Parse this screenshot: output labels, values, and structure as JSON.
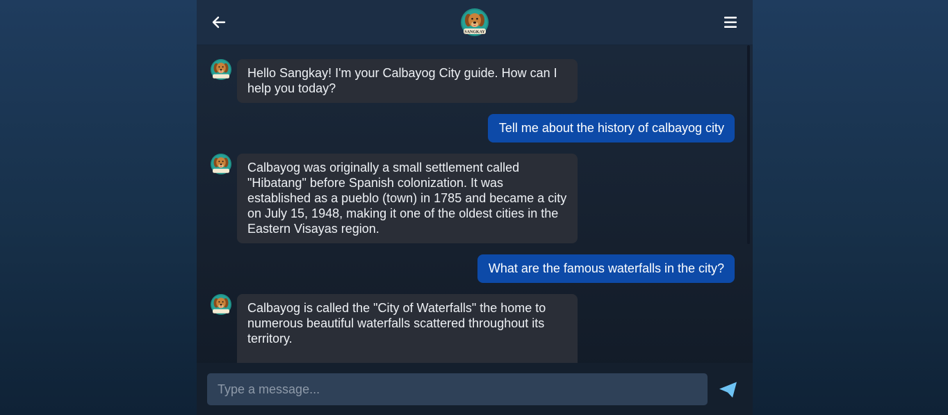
{
  "header": {
    "back_icon": "arrow-left-icon",
    "avatar_label": "SANGKAY",
    "menu_icon": "hamburger-menu-icon"
  },
  "messages": [
    {
      "role": "bot",
      "text": "Hello Sangkay! I'm your Calbayog City guide. How can I help you today?"
    },
    {
      "role": "user",
      "text": "Tell me about the history of calbayog city"
    },
    {
      "role": "bot",
      "text": "Calbayog was originally a small settlement called \"Hibatang\" before Spanish colonization. It was established as a pueblo (town) in 1785 and became a city on July 15, 1948, making it one of the oldest cities in the Eastern Visayas region."
    },
    {
      "role": "user",
      "text": "What are the famous waterfalls in the city?"
    },
    {
      "role": "bot",
      "text": "Calbayog is called the \"City of Waterfalls\" the home to numerous beautiful waterfalls scattered throughout its territory."
    }
  ],
  "composer": {
    "placeholder": "Type a message...",
    "value": "",
    "send_icon": "paper-plane-send-icon"
  },
  "colors": {
    "user_bubble": "#0d4aa8",
    "bot_bubble": "#2a2e37",
    "accent": "#6ec3f4"
  }
}
